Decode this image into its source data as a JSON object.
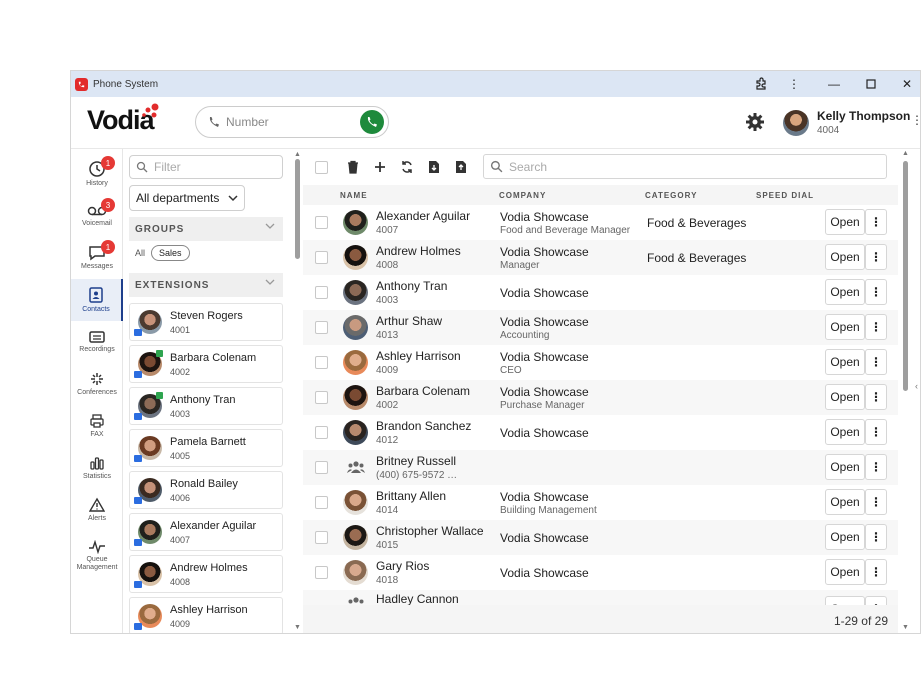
{
  "window": {
    "title": "Phone System"
  },
  "header": {
    "logo": "Vodia",
    "number_placeholder": "Number",
    "user_name": "Kelly Thompson",
    "user_ext": "4004"
  },
  "nav": [
    {
      "label": "History",
      "badge": "1"
    },
    {
      "label": "Voicemail",
      "badge": "3"
    },
    {
      "label": "Messages",
      "badge": "1"
    },
    {
      "label": "Contacts",
      "badge": ""
    },
    {
      "label": "Recordings",
      "badge": ""
    },
    {
      "label": "Conferences",
      "badge": ""
    },
    {
      "label": "FAX",
      "badge": ""
    },
    {
      "label": "Statistics",
      "badge": ""
    },
    {
      "label": "Alerts",
      "badge": ""
    },
    {
      "label": "Queue Management",
      "badge": ""
    }
  ],
  "sidebar": {
    "filter_placeholder": "Filter",
    "department": "All departments",
    "groups_label": "GROUPS",
    "chip_all": "All",
    "chip_sales": "Sales",
    "extensions_label": "EXTENSIONS",
    "extensions": [
      {
        "name": "Steven Rogers",
        "ext": "4001"
      },
      {
        "name": "Barbara Colenam",
        "ext": "4002"
      },
      {
        "name": "Anthony Tran",
        "ext": "4003"
      },
      {
        "name": "Pamela Barnett",
        "ext": "4005"
      },
      {
        "name": "Ronald Bailey",
        "ext": "4006"
      },
      {
        "name": "Alexander Aguilar",
        "ext": "4007"
      },
      {
        "name": "Andrew Holmes",
        "ext": "4008"
      },
      {
        "name": "Ashley Harrison",
        "ext": "4009"
      }
    ]
  },
  "main": {
    "search_placeholder": "Search",
    "columns": {
      "name": "NAME",
      "company": "COMPANY",
      "category": "CATEGORY",
      "speed_dial": "SPEED DIAL"
    },
    "open_label": "Open",
    "rows": [
      {
        "name": "Alexander Aguilar",
        "ext": "4007",
        "company": "Vodia Showcase",
        "title": "Food and Beverage Manager",
        "category": "Food & Beverages"
      },
      {
        "name": "Andrew Holmes",
        "ext": "4008",
        "company": "Vodia Showcase",
        "title": "Manager",
        "category": "Food & Beverages"
      },
      {
        "name": "Anthony Tran",
        "ext": "4003",
        "company": "Vodia Showcase",
        "title": "",
        "category": ""
      },
      {
        "name": "Arthur Shaw",
        "ext": "4013",
        "company": "Vodia Showcase",
        "title": "Accounting",
        "category": ""
      },
      {
        "name": "Ashley Harrison",
        "ext": "4009",
        "company": "Vodia Showcase",
        "title": "CEO",
        "category": ""
      },
      {
        "name": "Barbara Colenam",
        "ext": "4002",
        "company": "Vodia Showcase",
        "title": "Purchase Manager",
        "category": ""
      },
      {
        "name": "Brandon Sanchez",
        "ext": "4012",
        "company": "Vodia Showcase",
        "title": "",
        "category": ""
      },
      {
        "name": "Britney Russell",
        "ext": "(400) 675-9572 …",
        "company": "",
        "title": "",
        "category": ""
      },
      {
        "name": "Brittany Allen",
        "ext": "4014",
        "company": "Vodia Showcase",
        "title": "Building Management",
        "category": ""
      },
      {
        "name": "Christopher Wallace",
        "ext": "4015",
        "company": "Vodia Showcase",
        "title": "",
        "category": ""
      },
      {
        "name": "Gary Rios",
        "ext": "4018",
        "company": "Vodia Showcase",
        "title": "",
        "category": ""
      },
      {
        "name": "Hadley Cannon",
        "ext": "",
        "company": "",
        "title": "",
        "category": ""
      }
    ],
    "pagination": "1-29 of 29"
  }
}
